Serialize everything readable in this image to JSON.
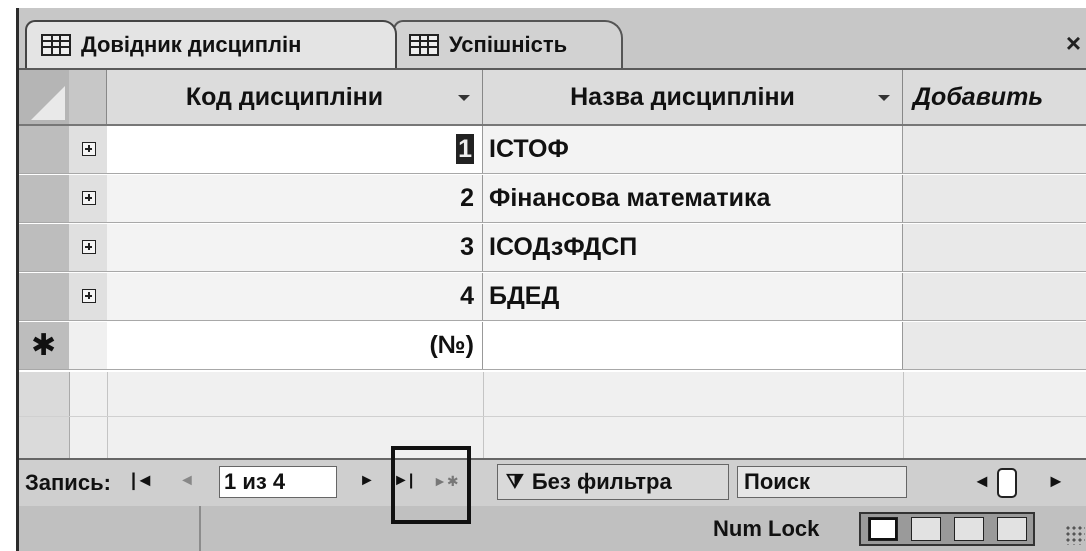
{
  "tabs": [
    {
      "label": "Довідник дисциплін",
      "active": true
    },
    {
      "label": "Успішність",
      "active": false
    }
  ],
  "close_glyph": "×",
  "columns": [
    "Код дисципліни",
    "Назва дисципліни",
    "Добавить"
  ],
  "rows": [
    {
      "code": "1",
      "name": "ІСТОФ"
    },
    {
      "code": "2",
      "name": "Фінансова математика"
    },
    {
      "code": "3",
      "name": "ІСОДзФДСП"
    },
    {
      "code": "4",
      "name": "БДЕД"
    }
  ],
  "new_row": {
    "marker": "✱",
    "code_placeholder": "(№)"
  },
  "nav": {
    "label": "Запись:",
    "first": "|◄",
    "prev": "◄",
    "record": "1 из 4",
    "next": "►",
    "last": "►|",
    "new": "►✱",
    "filter": "Без фильтра",
    "search": "Поиск"
  },
  "status": {
    "numlock": "Num Lock"
  },
  "icons": [
    "table-icon",
    "expand-plus-icon",
    "dropdown-arrow-icon",
    "new-record-star-icon",
    "filter-icon",
    "resize-grip-icon"
  ]
}
